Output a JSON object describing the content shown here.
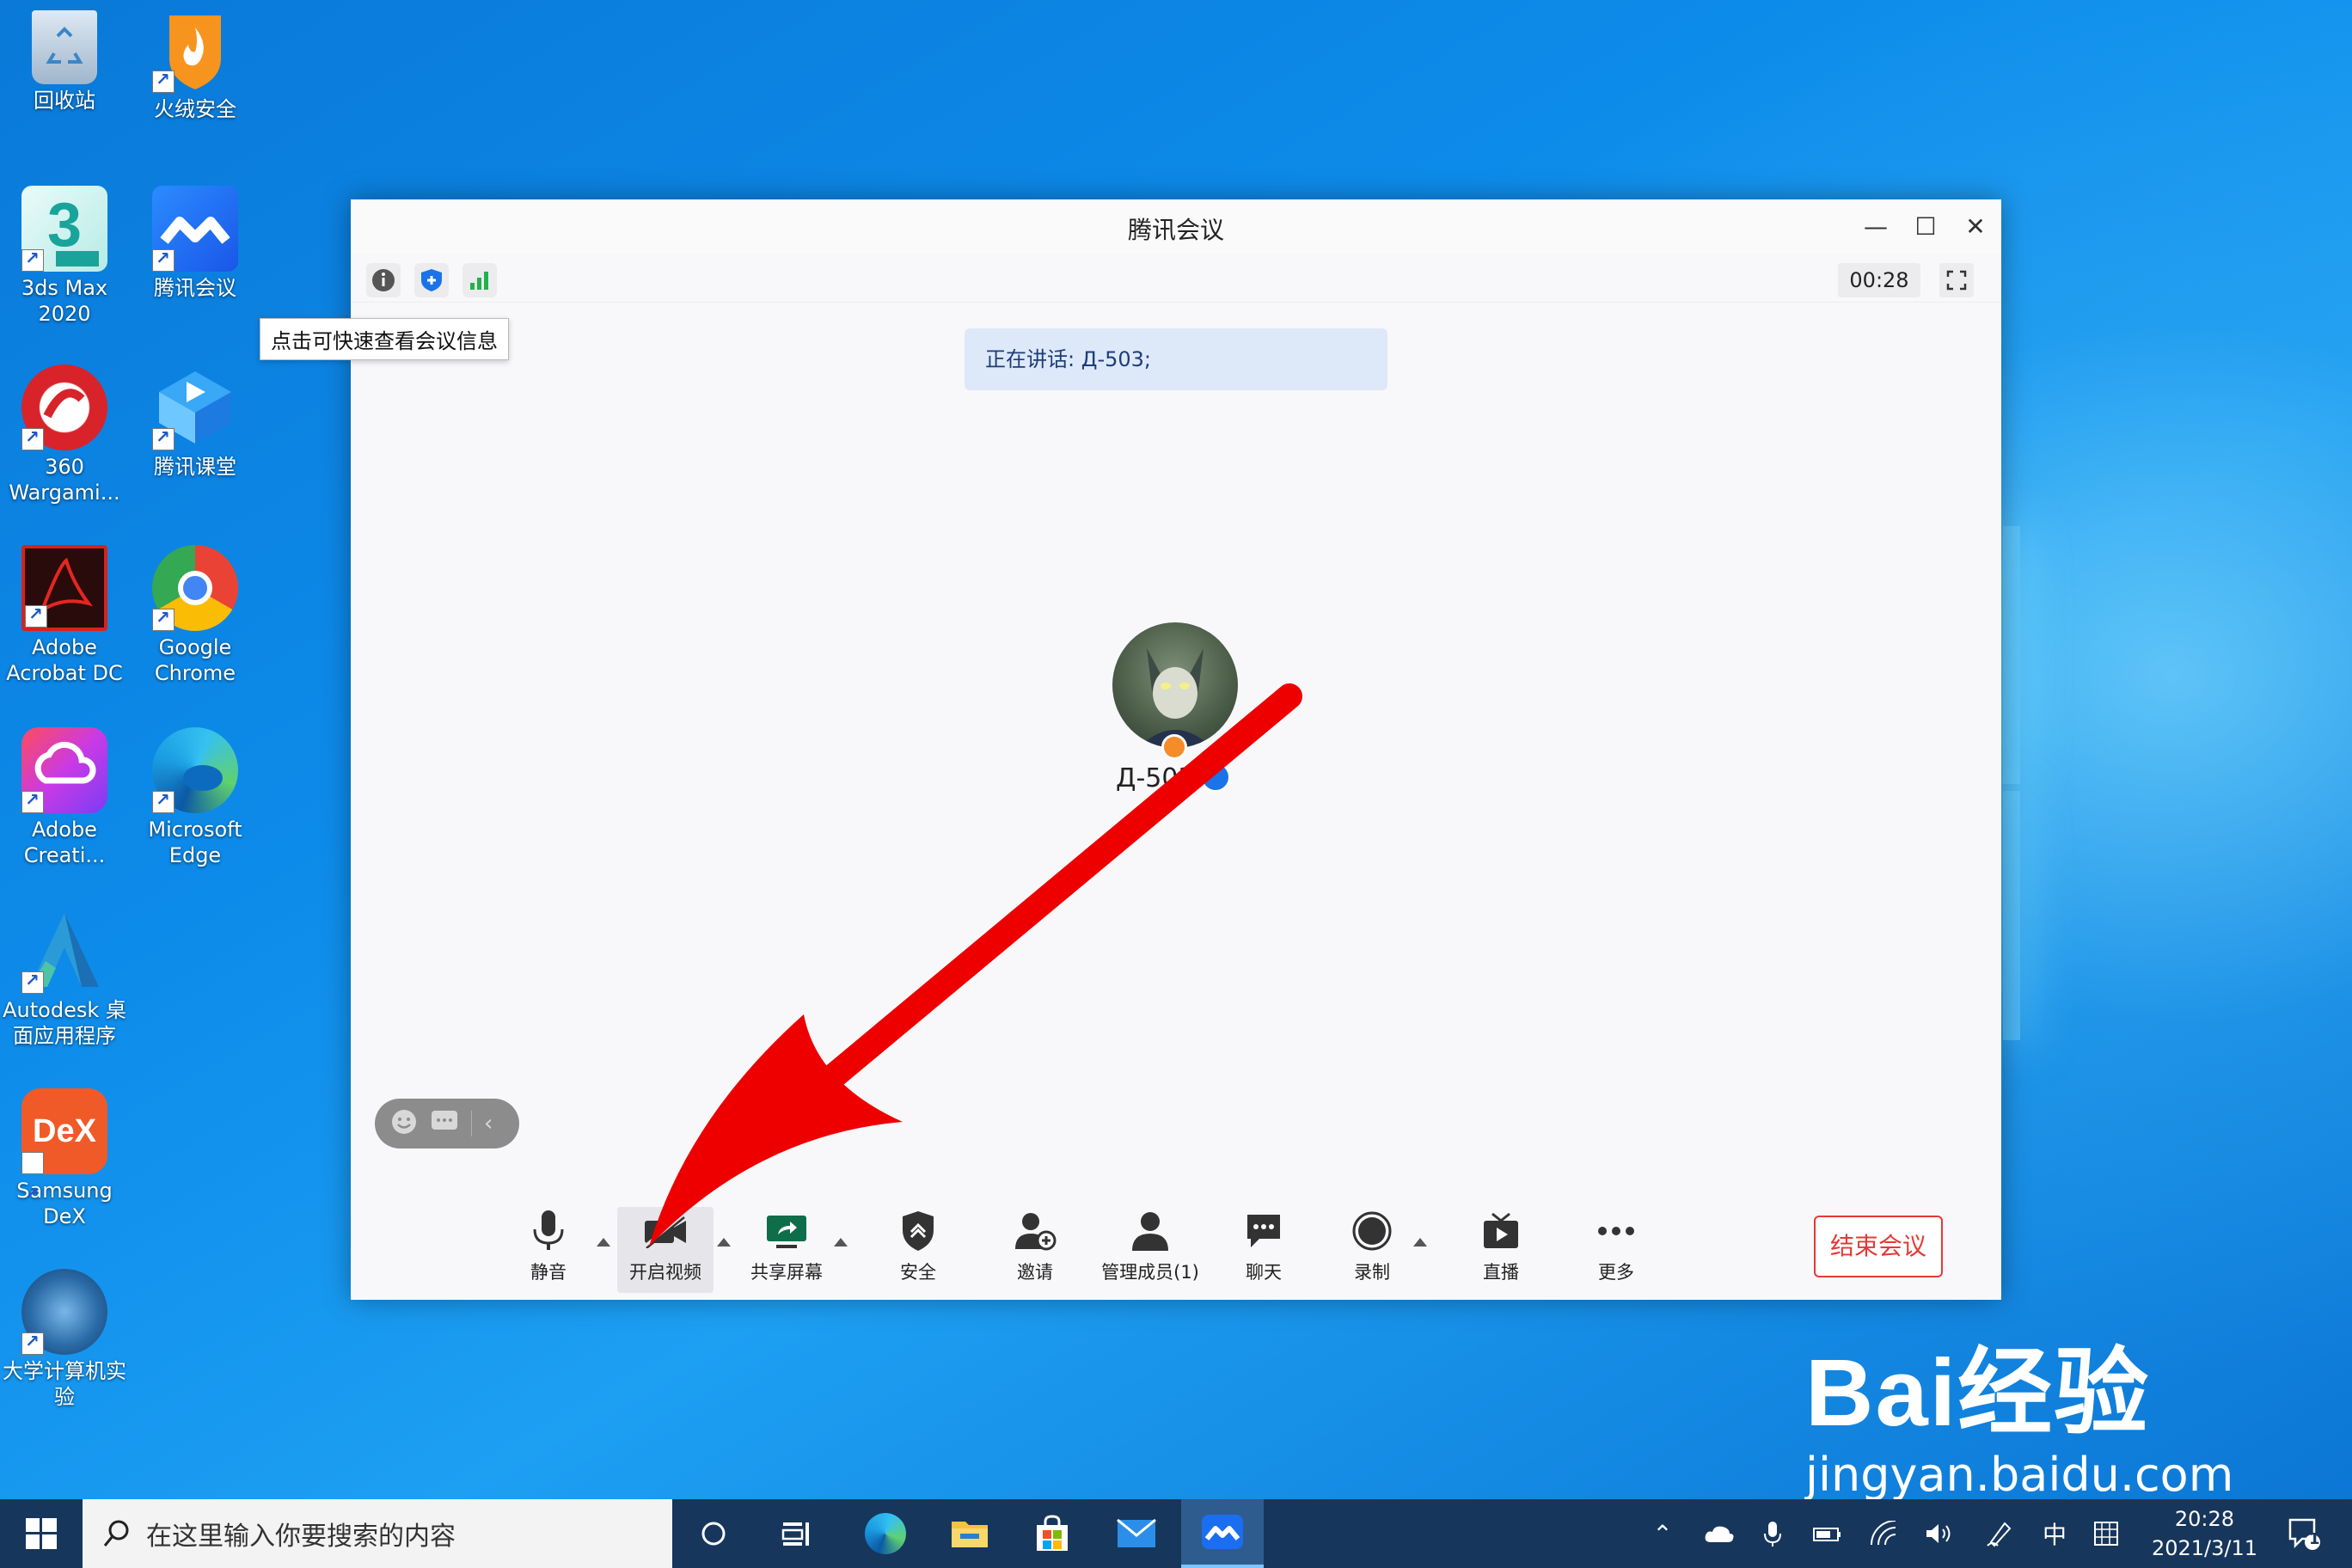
{
  "desktop_icons": [
    {
      "id": "recycle",
      "label": "回收站"
    },
    {
      "id": "huorong",
      "label": "火绒安全"
    },
    {
      "id": "3dsmax",
      "label": "3ds Max 2020"
    },
    {
      "id": "tencent-meeting",
      "label": "腾讯会议"
    },
    {
      "id": "360",
      "label": "360 Wargami..."
    },
    {
      "id": "tencent-class",
      "label": "腾讯课堂"
    },
    {
      "id": "acrobat",
      "label": "Adobe Acrobat DC"
    },
    {
      "id": "chrome",
      "label": "Google Chrome"
    },
    {
      "id": "creative",
      "label": "Adobe Creati..."
    },
    {
      "id": "edge",
      "label": "Microsoft Edge"
    },
    {
      "id": "autodesk",
      "label": "Autodesk 桌面应用程序"
    },
    {
      "id": "dex",
      "label": "Samsung DeX"
    },
    {
      "id": "univ",
      "label": "大学计算机实验"
    }
  ],
  "meeting": {
    "title": "腾讯会议",
    "timer": "00:28",
    "tooltip": "点击可快速查看会议信息",
    "speaking": "正在讲话: Д-503;",
    "participant_name": "Д-503",
    "toolbar": {
      "mute": "静音",
      "video": "开启视频",
      "share": "共享屏幕",
      "security": "安全",
      "invite": "邀请",
      "members": "管理成员(1)",
      "chat": "聊天",
      "record": "录制",
      "live": "直播",
      "more": "更多",
      "end": "结束会议"
    }
  },
  "taskbar": {
    "search_placeholder": "在这里输入你要搜索的内容",
    "ime": "中",
    "time": "20:28",
    "date": "2021/3/11",
    "notification_count": "1"
  },
  "watermark": {
    "brand": "Bai经验",
    "url": "jingyan.baidu.com"
  },
  "colors": {
    "accent": "#1a73e8",
    "end_button": "#e53935",
    "arrow": "#ee0000",
    "taskbar": "#17365c"
  }
}
